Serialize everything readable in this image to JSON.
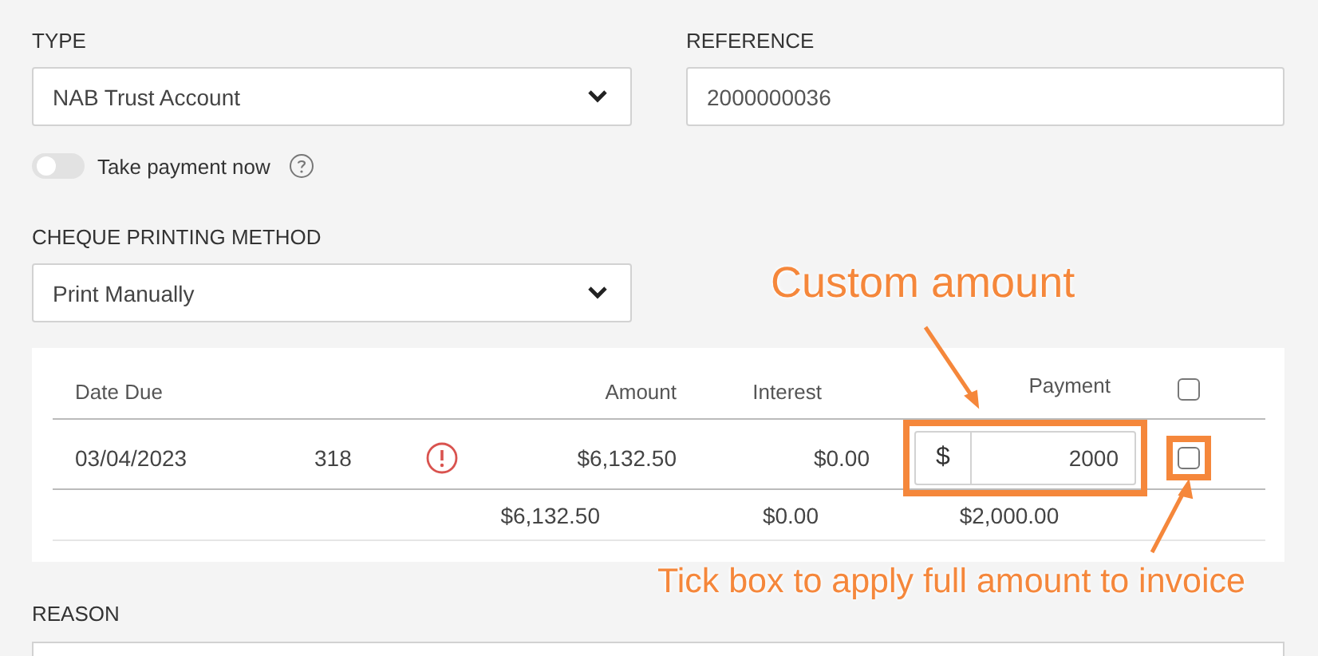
{
  "type_field": {
    "label": "TYPE",
    "value": "NAB Trust Account"
  },
  "reference": {
    "label": "REFERENCE",
    "value": "2000000036"
  },
  "take_payment": {
    "label": "Take payment now",
    "on": false
  },
  "cheque_method": {
    "label": "CHEQUE PRINTING METHOD",
    "value": "Print Manually"
  },
  "table": {
    "columns": {
      "date": "Date Due",
      "amount": "Amount",
      "interest": "Interest",
      "payment": "Payment"
    },
    "select_all_checked": false,
    "rows": [
      {
        "date": "03/04/2023",
        "number": "318",
        "warning": true,
        "amount": "$6,132.50",
        "interest": "$0.00",
        "currency": "$",
        "payment": "2000",
        "checked": false
      }
    ],
    "totals": {
      "amount": "$6,132.50",
      "interest": "$0.00",
      "payment": "$2,000.00"
    }
  },
  "reason": {
    "label": "REASON"
  },
  "annotations": {
    "custom_amount": "Custom amount",
    "tick_box": "Tick box to apply full amount to invoice"
  }
}
